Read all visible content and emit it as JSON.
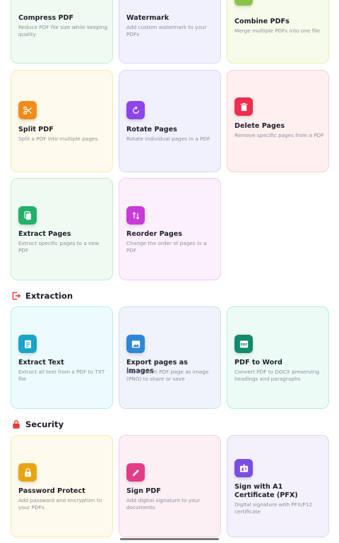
{
  "cards": {
    "compress": {
      "title": "Compress PDF",
      "desc": "Reduce PDF file size while keeping quality"
    },
    "watermark": {
      "title": "Watermark",
      "desc": "Add custom watermark to your PDFs"
    },
    "combine": {
      "title": "Combine PDFs",
      "desc": "Merge multiple PDFs into one file"
    },
    "split": {
      "title": "Split PDF",
      "desc": "Split a PDF into multiple pages"
    },
    "rotate": {
      "title": "Rotate Pages",
      "desc": "Rotate individual pages in a PDF"
    },
    "delete": {
      "title": "Delete Pages",
      "desc": "Remove specific pages from a PDF"
    },
    "extract": {
      "title": "Extract Pages",
      "desc": "Extract specific pages to a new PDF"
    },
    "reorder": {
      "title": "Reorder Pages",
      "desc": "Change the order of pages in a PDF"
    },
    "extract_text": {
      "title": "Extract Text",
      "desc": "Extract all text from a PDF to TXT file"
    },
    "export_images": {
      "title": "Export pages as images",
      "desc": "Export each PDF page as image (PNG) to share or save"
    },
    "pdf_to_word": {
      "title": "PDF to Word",
      "desc": "Convert PDF to DOCX preserving headings and paragraphs"
    },
    "password": {
      "title": "Password Protect",
      "desc": "Add password and encryption to your PDFs"
    },
    "sign": {
      "title": "Sign PDF",
      "desc": "Add digital signature to your documents"
    },
    "sign_a1": {
      "title": "Sign with A1 Certificate (PFX)",
      "desc": "Digital signature with PFX/P12 certificate"
    }
  },
  "sections": {
    "extraction": {
      "title": "Extraction",
      "icon": "export-icon",
      "color": "#e53935"
    },
    "security": {
      "title": "Security",
      "icon": "lock-icon",
      "color": "#e53935"
    }
  },
  "icon_colors": {
    "split": "#f28c18",
    "rotate": "#8e44e8",
    "delete": "#ee2d4f",
    "extract": "#22b06a",
    "reorder": "#c93ad8",
    "extract_text": "#1aa3c9",
    "export_images": "#2f86d6",
    "pdf_to_word": "#138a6b",
    "password": "#e8a511",
    "sign": "#e23d88",
    "sign_a1": "#7a4fe0"
  }
}
